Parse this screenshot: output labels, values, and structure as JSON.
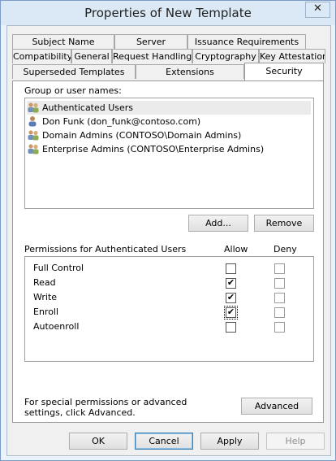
{
  "window": {
    "title": "Properties of New Template",
    "close_label": "✕"
  },
  "tabs": {
    "row1": [
      {
        "id": "subject-name",
        "label": "Subject Name"
      },
      {
        "id": "server",
        "label": "Server"
      },
      {
        "id": "issuance-requirements",
        "label": "Issuance Requirements"
      }
    ],
    "row2": [
      {
        "id": "compatibility",
        "label": "Compatibility"
      },
      {
        "id": "general",
        "label": "General"
      },
      {
        "id": "request-handling",
        "label": "Request Handling"
      },
      {
        "id": "cryptography",
        "label": "Cryptography"
      },
      {
        "id": "key-attestation",
        "label": "Key Attestation"
      }
    ],
    "row3": [
      {
        "id": "superseded-templates",
        "label": "Superseded Templates"
      },
      {
        "id": "extensions",
        "label": "Extensions"
      },
      {
        "id": "security",
        "label": "Security"
      }
    ],
    "active": "Security"
  },
  "security": {
    "group_label": "Group or user names:",
    "users": [
      {
        "name": "Authenticated Users",
        "selected": true,
        "icon": "group-icon"
      },
      {
        "name": "Don Funk (don_funk@contoso.com)",
        "selected": false,
        "icon": "user-icon"
      },
      {
        "name": "Domain Admins (CONTOSO\\Domain Admins)",
        "selected": false,
        "icon": "group-icon"
      },
      {
        "name": "Enterprise Admins (CONTOSO\\Enterprise Admins)",
        "selected": false,
        "icon": "group-icon"
      }
    ],
    "add_label": "Add...",
    "remove_label": "Remove",
    "permissions_label": "Permissions for Authenticated Users",
    "allow_header": "Allow",
    "deny_header": "Deny",
    "permissions": [
      {
        "name": "Full Control",
        "allow": false,
        "deny": false
      },
      {
        "name": "Read",
        "allow": true,
        "deny": false
      },
      {
        "name": "Write",
        "allow": true,
        "deny": false
      },
      {
        "name": "Enroll",
        "allow": true,
        "deny": false
      },
      {
        "name": "Autoenroll",
        "allow": false,
        "deny": false
      }
    ],
    "special_note": "For special permissions or advanced settings, click Advanced.",
    "advanced_label": "Advanced"
  },
  "footer": {
    "ok_label": "OK",
    "cancel_label": "Cancel",
    "apply_label": "Apply",
    "help_label": "Help"
  },
  "colors": {
    "title_bar": "#dbe9f6",
    "selection": "#ebebeb"
  }
}
